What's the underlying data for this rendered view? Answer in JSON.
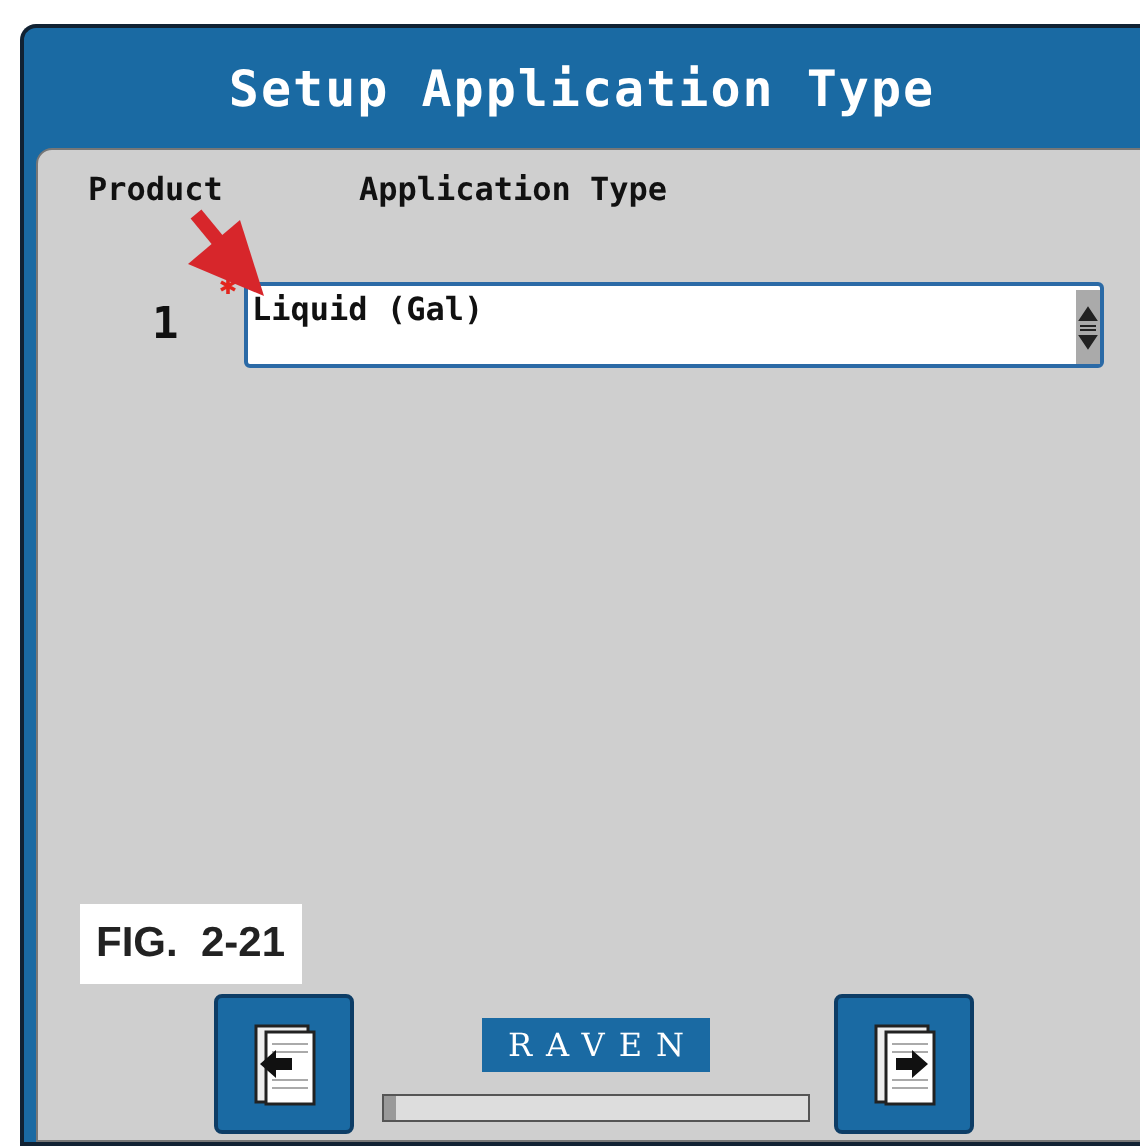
{
  "window": {
    "title": "Setup Application Type"
  },
  "columns": [
    "Product",
    "Application Type"
  ],
  "rows": [
    {
      "product": "1",
      "required": true,
      "value": "Liquid (Gal)"
    }
  ],
  "footer": {
    "logo": "RAVEN",
    "progress": {
      "level": 0.03
    }
  },
  "figure_label": "FIG.  2-21"
}
